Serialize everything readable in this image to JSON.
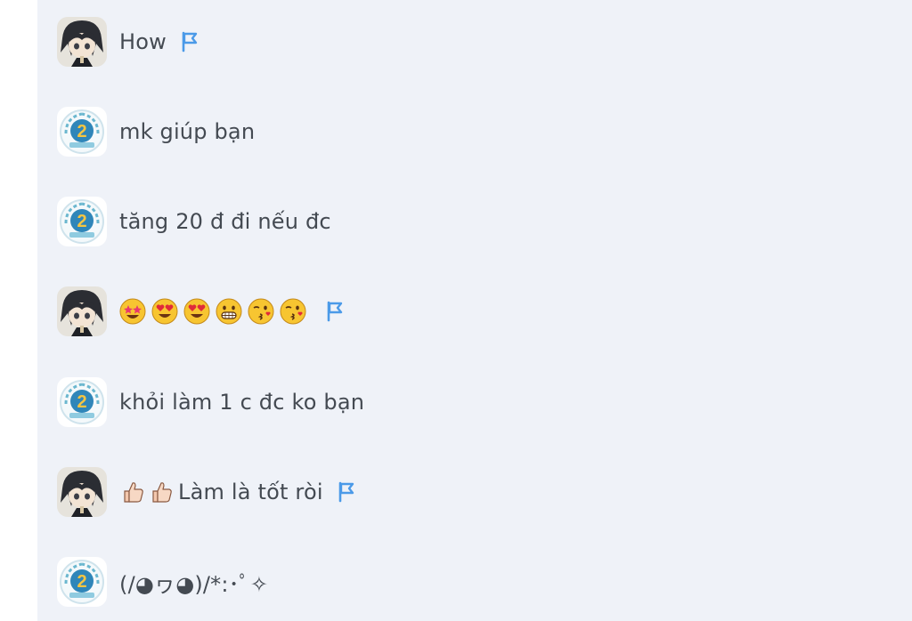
{
  "messages": [
    {
      "sender": "anime-user",
      "text": "How",
      "flagged": true
    },
    {
      "sender": "olm-bot",
      "text": "mk giúp bạn",
      "flagged": false
    },
    {
      "sender": "olm-bot",
      "text": "tăng 20 đ đi nếu đc",
      "flagged": false
    },
    {
      "sender": "anime-user",
      "text": "",
      "emojis": [
        "star-struck",
        "heart-eyes",
        "heart-eyes",
        "grin",
        "kiss-wink",
        "kiss-wink"
      ],
      "flagged": true
    },
    {
      "sender": "olm-bot",
      "text": "khỏi làm 1 c đc ko bạn",
      "flagged": false
    },
    {
      "sender": "anime-user",
      "text": "Làm là tốt ròi",
      "emojis": [
        "thumbs-up",
        "thumbs-up"
      ],
      "flagged": true
    },
    {
      "sender": "olm-bot",
      "text": "(/◕ヮ◕)/*:･ﾟ✧",
      "flagged": false
    }
  ],
  "colors": {
    "panel_background": "#eff2f8",
    "text": "#444a52",
    "flag": "#4b9ae8"
  },
  "icons": {
    "flag": "flag-icon",
    "anime_avatar": "anime-avatar",
    "olm_avatar": "olm-badge-avatar"
  }
}
